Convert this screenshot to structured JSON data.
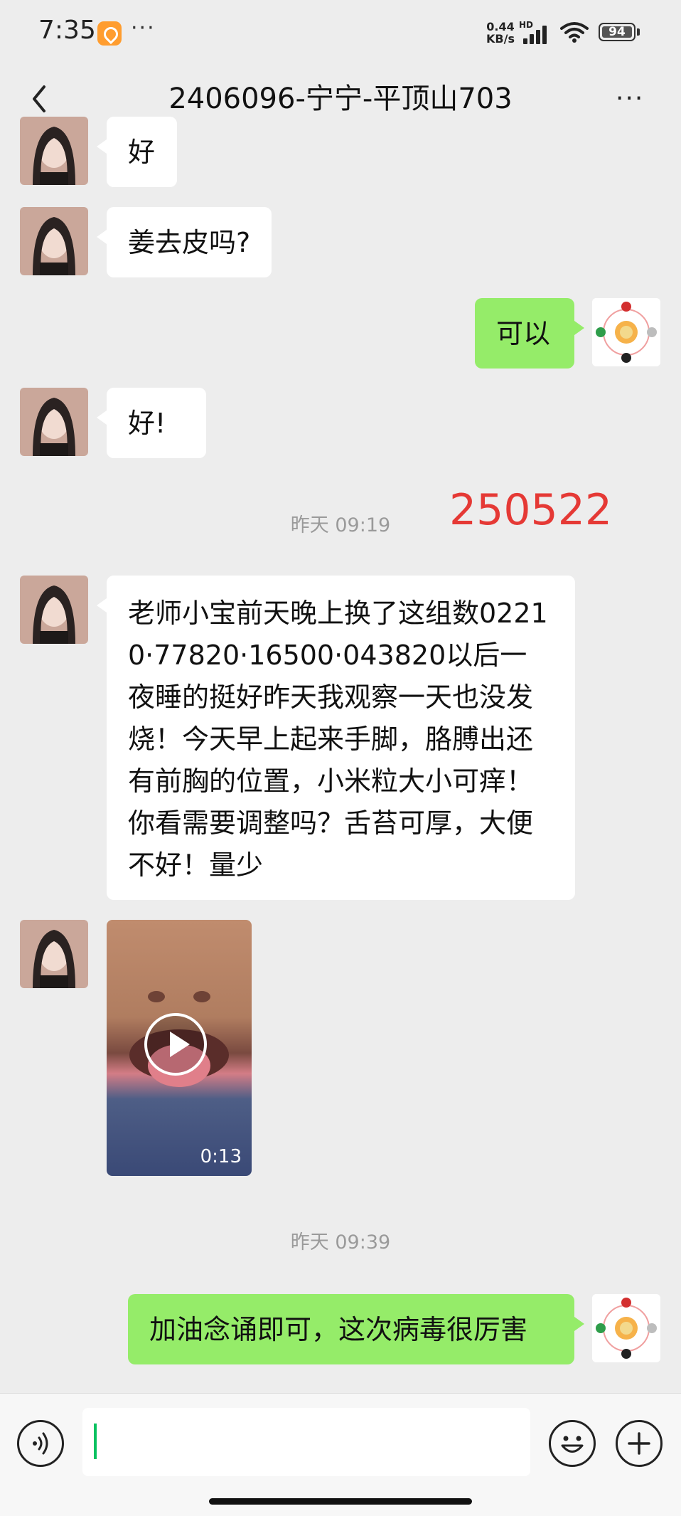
{
  "status_bar": {
    "time": "7:35",
    "network_speed_value": "0.44",
    "network_speed_unit": "KB/s",
    "hd_label": "HD",
    "battery": "94"
  },
  "header": {
    "title": "2406096-宁宁-平顶山703"
  },
  "messages": [
    {
      "side": "in",
      "text": "好"
    },
    {
      "side": "in",
      "text": "姜去皮吗?"
    },
    {
      "side": "out",
      "text": "可以"
    },
    {
      "side": "in",
      "text": "好!"
    },
    {
      "side": "in",
      "text": "老师小宝前天晚上换了这组数02210·77820·16500·043820以后一夜睡的挺好昨天我观察一天也没发烧！今天早上起来手脚，胳膊出还有前胸的位置，小米粒大小可痒！你看需要调整吗？舌苔可厚，大便不好！量少"
    },
    {
      "side": "in",
      "type": "video",
      "duration": "0:13"
    },
    {
      "side": "out",
      "text": "加油念诵即可，这次病毒很厉害"
    }
  ],
  "timestamps": [
    "昨天 09:19",
    "昨天 09:39"
  ],
  "annotation": "250522",
  "colors": {
    "background": "#ededed",
    "outgoing_bubble": "#95ec69",
    "incoming_bubble": "#ffffff",
    "annotation": "#e53935",
    "caret": "#07c160"
  },
  "icons": [
    "back-icon",
    "more-icon",
    "voice-icon",
    "emoji-icon",
    "plus-icon",
    "play-icon"
  ]
}
